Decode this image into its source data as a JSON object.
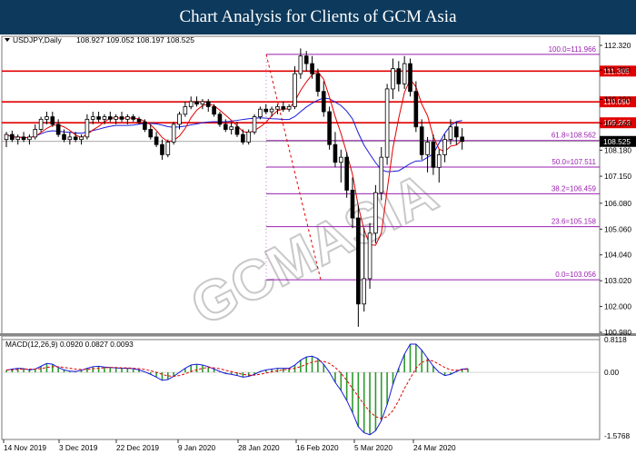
{
  "banner_title": "Chart Analysis for Clients of GCM Asia",
  "watermark": "GCMASIA",
  "chart_data": [
    {
      "type": "candlestick",
      "title": "USDJPY,Daily",
      "ohlc_label": "108.927 109.052 108.197 108.525",
      "xlabel": "",
      "ylabel": "",
      "ylim": [
        100.98,
        112.32
      ],
      "y_ticks": [
        "112.320",
        "111.350",
        "110.190",
        "109.240",
        "108.180",
        "107.150",
        "106.080",
        "105.060",
        "104.040",
        "103.020",
        "102.000",
        "100.980"
      ],
      "x_ticks": [
        "14 Nov 2019",
        "3 Dec 2019",
        "22 Dec 2019",
        "9 Jan 2020",
        "28 Jan 2020",
        "16 Feb 2020",
        "5 Mar 2020",
        "24 Mar 2020"
      ],
      "last_price": 108.525,
      "resistance_levels": [
        {
          "value": 111.305,
          "label": "111.305",
          "color": "#e00000"
        },
        {
          "value": 110.09,
          "label": "110.090",
          "color": "#e00000"
        },
        {
          "value": 109.262,
          "label": "109.262",
          "color": "#e00000"
        }
      ],
      "fibonacci": [
        {
          "ratio": "100.0",
          "value": 111.966,
          "label": "100.0=111.966"
        },
        {
          "ratio": "61.8",
          "value": 108.562,
          "label": "61.8=108.562"
        },
        {
          "ratio": "50.0",
          "value": 107.511,
          "label": "50.0=107.511"
        },
        {
          "ratio": "38.2",
          "value": 106.459,
          "label": "38.2=106.459"
        },
        {
          "ratio": "23.6",
          "value": 105.158,
          "label": "23.6=105.158"
        },
        {
          "ratio": "0.0",
          "value": 103.056,
          "label": "0.0=103.056"
        }
      ],
      "fib_color": "#9a1fb0",
      "series_colors": {
        "ma_fast": "#e00000",
        "ma_slow": "#1a1adb",
        "candle": "#000000",
        "bull_fill": "#ffffff",
        "bear_fill": "#000000"
      },
      "trendline_color": "#e00000",
      "candles": [
        [
          108.6,
          108.9,
          108.3,
          108.8
        ],
        [
          108.8,
          108.95,
          108.5,
          108.6
        ],
        [
          108.6,
          108.8,
          108.4,
          108.7
        ],
        [
          108.7,
          108.9,
          108.5,
          108.6
        ],
        [
          108.6,
          108.8,
          108.4,
          108.7
        ],
        [
          108.7,
          109.2,
          108.6,
          109.0
        ],
        [
          109.0,
          109.5,
          108.9,
          109.4
        ],
        [
          109.4,
          109.7,
          109.2,
          109.5
        ],
        [
          109.5,
          109.7,
          109.1,
          109.2
        ],
        [
          109.2,
          109.4,
          108.7,
          108.8
        ],
        [
          108.8,
          109.0,
          108.5,
          108.6
        ],
        [
          108.6,
          108.9,
          108.4,
          108.7
        ],
        [
          108.7,
          108.9,
          108.5,
          108.6
        ],
        [
          108.6,
          108.8,
          108.4,
          108.7
        ],
        [
          108.7,
          109.6,
          108.6,
          109.4
        ],
        [
          109.4,
          109.7,
          109.2,
          109.5
        ],
        [
          109.5,
          109.7,
          109.3,
          109.4
        ],
        [
          109.4,
          109.6,
          109.2,
          109.5
        ],
        [
          109.5,
          109.7,
          109.3,
          109.4
        ],
        [
          109.4,
          109.6,
          109.2,
          109.5
        ],
        [
          109.5,
          109.7,
          109.3,
          109.4
        ],
        [
          109.4,
          109.6,
          109.2,
          109.5
        ],
        [
          109.5,
          109.6,
          109.3,
          109.4
        ],
        [
          109.4,
          109.5,
          109.2,
          109.3
        ],
        [
          109.3,
          109.4,
          108.9,
          109.0
        ],
        [
          109.0,
          109.2,
          108.6,
          108.7
        ],
        [
          108.7,
          108.9,
          108.3,
          108.4
        ],
        [
          108.4,
          108.6,
          107.8,
          108.0
        ],
        [
          108.0,
          108.6,
          107.9,
          108.5
        ],
        [
          108.5,
          109.3,
          108.4,
          109.2
        ],
        [
          109.2,
          109.7,
          109.0,
          109.6
        ],
        [
          109.6,
          110.1,
          109.5,
          109.9
        ],
        [
          109.9,
          110.3,
          109.8,
          110.1
        ],
        [
          110.1,
          110.3,
          109.9,
          110.0
        ],
        [
          110.0,
          110.2,
          109.8,
          110.1
        ],
        [
          110.1,
          110.2,
          109.7,
          109.9
        ],
        [
          109.9,
          110.0,
          109.5,
          109.6
        ],
        [
          109.6,
          109.7,
          109.1,
          109.2
        ],
        [
          109.2,
          109.4,
          108.9,
          109.0
        ],
        [
          109.0,
          109.3,
          108.8,
          109.1
        ],
        [
          109.1,
          109.3,
          108.7,
          108.8
        ],
        [
          108.8,
          109.0,
          108.4,
          108.5
        ],
        [
          108.5,
          109.0,
          108.4,
          108.9
        ],
        [
          108.9,
          109.6,
          108.8,
          109.5
        ],
        [
          109.5,
          109.9,
          109.4,
          109.8
        ],
        [
          109.8,
          110.0,
          109.6,
          109.7
        ],
        [
          109.7,
          109.9,
          109.5,
          109.8
        ],
        [
          109.8,
          110.0,
          109.6,
          109.9
        ],
        [
          109.9,
          110.1,
          109.7,
          109.8
        ],
        [
          109.8,
          110.0,
          109.7,
          109.9
        ],
        [
          109.9,
          111.5,
          109.8,
          111.2
        ],
        [
          111.2,
          112.2,
          111.0,
          111.9
        ],
        [
          111.9,
          112.1,
          111.3,
          111.6
        ],
        [
          111.6,
          111.9,
          111.0,
          111.2
        ],
        [
          111.2,
          111.4,
          110.3,
          110.5
        ],
        [
          110.5,
          110.9,
          109.5,
          109.7
        ],
        [
          109.7,
          109.9,
          108.2,
          108.4
        ],
        [
          108.4,
          108.9,
          107.5,
          107.7
        ],
        [
          107.7,
          108.2,
          106.9,
          107.9
        ],
        [
          107.9,
          108.1,
          106.3,
          106.6
        ],
        [
          106.6,
          107.1,
          105.1,
          105.5
        ],
        [
          105.5,
          106.0,
          101.2,
          102.1
        ],
        [
          102.1,
          105.1,
          101.8,
          103.1
        ],
        [
          103.1,
          105.3,
          102.7,
          104.9
        ],
        [
          104.9,
          106.8,
          104.5,
          106.5
        ],
        [
          106.5,
          108.3,
          106.2,
          107.9
        ],
        [
          107.9,
          110.8,
          107.6,
          110.6
        ],
        [
          110.6,
          111.8,
          110.2,
          111.4
        ],
        [
          111.4,
          111.7,
          110.5,
          110.8
        ],
        [
          110.8,
          111.9,
          110.6,
          111.6
        ],
        [
          111.6,
          111.8,
          110.3,
          110.5
        ],
        [
          110.5,
          110.9,
          108.9,
          109.1
        ],
        [
          109.1,
          109.4,
          107.8,
          108.0
        ],
        [
          108.0,
          108.7,
          107.3,
          108.5
        ],
        [
          108.5,
          108.8,
          107.2,
          107.5
        ],
        [
          107.5,
          108.2,
          106.9,
          108.0
        ],
        [
          108.0,
          108.8,
          107.7,
          108.6
        ],
        [
          108.6,
          109.4,
          108.4,
          109.1
        ],
        [
          109.1,
          109.3,
          108.4,
          108.7
        ],
        [
          108.7,
          109.05,
          108.2,
          108.525
        ]
      ],
      "macd": {
        "label": "MACD(12,26,9) 0.0920 0.0827 0.0093",
        "ylim": [
          -1.5768,
          0.8118
        ],
        "y_ticks": [
          "0.8118",
          "0.00",
          "-1.5768"
        ],
        "main": [
          0.05,
          0.08,
          0.1,
          0.09,
          0.06,
          0.08,
          0.15,
          0.22,
          0.2,
          0.12,
          0.06,
          0.03,
          0.02,
          0.05,
          0.1,
          0.14,
          0.15,
          0.13,
          0.12,
          0.11,
          0.1,
          0.1,
          0.09,
          0.06,
          0.01,
          -0.05,
          -0.12,
          -0.2,
          -0.18,
          -0.1,
          0.0,
          0.1,
          0.18,
          0.2,
          0.18,
          0.14,
          0.08,
          0.02,
          -0.03,
          -0.05,
          -0.08,
          -0.12,
          -0.1,
          -0.05,
          0.02,
          0.06,
          0.08,
          0.1,
          0.1,
          0.1,
          0.18,
          0.3,
          0.38,
          0.4,
          0.34,
          0.2,
          0.0,
          -0.25,
          -0.45,
          -0.7,
          -1.0,
          -1.35,
          -1.5,
          -1.55,
          -1.45,
          -1.2,
          -0.8,
          -0.3,
          0.1,
          0.45,
          0.7,
          0.7,
          0.55,
          0.35,
          0.15,
          0.0,
          -0.08,
          -0.05,
          0.02,
          0.08,
          0.09
        ],
        "signal": [
          0.06,
          0.06,
          0.07,
          0.08,
          0.08,
          0.08,
          0.09,
          0.12,
          0.14,
          0.14,
          0.12,
          0.1,
          0.08,
          0.07,
          0.07,
          0.09,
          0.1,
          0.11,
          0.12,
          0.12,
          0.11,
          0.11,
          0.1,
          0.09,
          0.07,
          0.04,
          0.0,
          -0.05,
          -0.09,
          -0.1,
          -0.08,
          -0.04,
          0.02,
          0.06,
          0.1,
          0.12,
          0.11,
          0.09,
          0.05,
          0.02,
          -0.02,
          -0.05,
          -0.07,
          -0.07,
          -0.05,
          -0.02,
          0.01,
          0.04,
          0.06,
          0.08,
          0.1,
          0.14,
          0.2,
          0.25,
          0.28,
          0.27,
          0.22,
          0.12,
          -0.02,
          -0.2,
          -0.4,
          -0.6,
          -0.8,
          -0.98,
          -1.1,
          -1.15,
          -1.1,
          -0.95,
          -0.7,
          -0.4,
          -0.15,
          0.1,
          0.25,
          0.3,
          0.28,
          0.2,
          0.12,
          0.06,
          0.05,
          0.06,
          0.08
        ]
      }
    }
  ]
}
